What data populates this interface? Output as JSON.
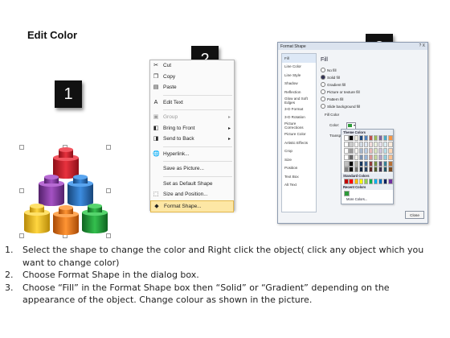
{
  "title": "Edit Color",
  "badges": [
    "1",
    "2",
    "3"
  ],
  "context_menu": {
    "items": [
      {
        "label": "Cut",
        "icon": "scissors-icon",
        "disabled": false,
        "submenu": false
      },
      {
        "label": "Copy",
        "icon": "copy-icon",
        "disabled": false,
        "submenu": false
      },
      {
        "label": "Paste",
        "icon": "paste-icon",
        "disabled": false,
        "submenu": false
      },
      {
        "label": "Edit Text",
        "icon": "edit-text-icon",
        "disabled": false,
        "submenu": false
      },
      {
        "label": "Group",
        "icon": "group-icon",
        "disabled": true,
        "submenu": true
      },
      {
        "label": "Bring to Front",
        "icon": "bring-front-icon",
        "disabled": false,
        "submenu": true
      },
      {
        "label": "Send to Back",
        "icon": "send-back-icon",
        "disabled": false,
        "submenu": true
      },
      {
        "label": "Hyperlink...",
        "icon": "hyperlink-icon",
        "disabled": false,
        "submenu": false
      },
      {
        "label": "Save as Picture...",
        "icon": "",
        "disabled": false,
        "submenu": false
      },
      {
        "label": "Set as Default Shape",
        "icon": "",
        "disabled": false,
        "submenu": false
      },
      {
        "label": "Size and Position...",
        "icon": "size-icon",
        "disabled": false,
        "submenu": false
      },
      {
        "label": "Format Shape...",
        "icon": "format-shape-icon",
        "disabled": false,
        "submenu": false,
        "highlighted": true
      }
    ]
  },
  "dialog": {
    "title": "Format Shape",
    "controls": "? X",
    "nav": [
      "Fill",
      "Line Color",
      "Line Style",
      "Shadow",
      "Reflection",
      "Glow and Soft Edges",
      "3-D Format",
      "3-D Rotation",
      "Picture Corrections",
      "Picture Color",
      "Artistic Effects",
      "Crop",
      "Size",
      "Position",
      "Text Box",
      "Alt Text"
    ],
    "selected_nav": "Fill",
    "fill_heading": "Fill",
    "options": [
      "No fill",
      "Solid fill",
      "Gradient fill",
      "Picture or texture fill",
      "Pattern fill",
      "Slide background fill"
    ],
    "selected_option": "Solid fill",
    "fill_color_label": "Fill Color",
    "color_label": "Color:",
    "transparency_label": "Transpa",
    "palette": {
      "theme_label": "Theme Colors",
      "standard_label": "Standard Colors",
      "recent_label": "Recent Colors",
      "more_label": "More Colors...",
      "theme_top": [
        "#ffffff",
        "#000000",
        "#eeece1",
        "#1f497d",
        "#4f81bd",
        "#c0504d",
        "#9bbb59",
        "#8064a2",
        "#4bacc6",
        "#f79646"
      ],
      "standard": [
        "#c00000",
        "#ff0000",
        "#ffc000",
        "#ffff00",
        "#92d050",
        "#00b050",
        "#00b0f0",
        "#0070c0",
        "#002060",
        "#7030a0"
      ],
      "recent": [
        "#2e9b3a"
      ]
    },
    "close_label": "Close"
  },
  "steps": [
    {
      "num": "1.",
      "text": "Select the shape to change the color and Right click the object( click any object which you want to change color)"
    },
    {
      "num": "2.",
      "text": "Choose Format Shape in the dialog box."
    },
    {
      "num": "3.",
      "text": "Choose “Fill” in the Format Shape box then “Solid” or “Gradient” depending on the appearance of the object. Change colour as shown in the picture."
    }
  ],
  "cylinder_colors": {
    "red": "#d9232f",
    "purple": "#8a3aa8",
    "blue": "#2a74c8",
    "yellow": "#f3c21b",
    "orange": "#ef7a1c",
    "green": "#24a23a"
  }
}
